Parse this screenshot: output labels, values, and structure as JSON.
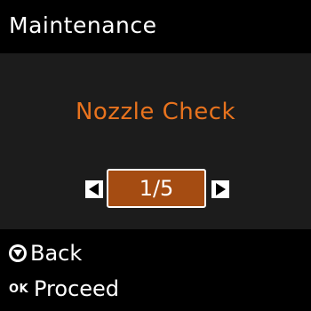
{
  "title": "Maintenance",
  "menu": {
    "item_label": "Nozzle Check",
    "page_indicator": "1/5",
    "current_page": 1,
    "total_pages": 5
  },
  "footer": {
    "back_label": "Back",
    "ok_badge": "OK",
    "proceed_label": "Proceed"
  },
  "icons": {
    "back": "stop-icon",
    "proceed": "ok-icon",
    "prev": "triangle-left-icon",
    "next": "triangle-right-icon"
  },
  "colors": {
    "background": "#000000",
    "panel": "#1c1c1c",
    "accent": "#e8731e",
    "selected_fill": "#a54c12",
    "text": "#ffffff"
  }
}
